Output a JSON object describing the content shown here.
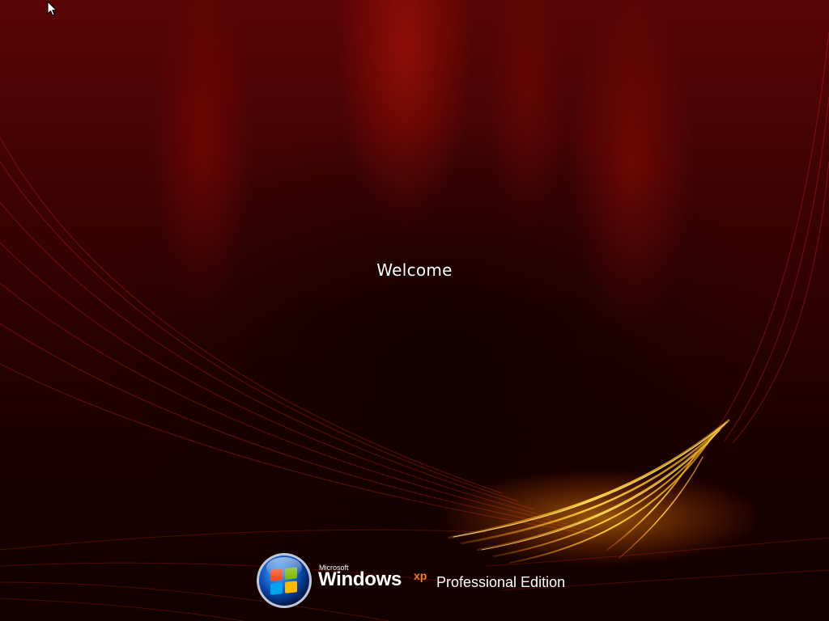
{
  "screen": {
    "welcome": "Welcome"
  },
  "branding": {
    "microsoft": "Microsoft",
    "windows": "Windows",
    "xp": "xp",
    "edition": "Professional Edition"
  },
  "icons": {
    "logo": "windows-orb-logo",
    "cursor": "mouse-pointer-arrow"
  },
  "colors": {
    "background": "#3a0202",
    "accent_glow": "#ffc21a",
    "xp_mark": "#ff7a1a",
    "text": "#ffffff"
  }
}
